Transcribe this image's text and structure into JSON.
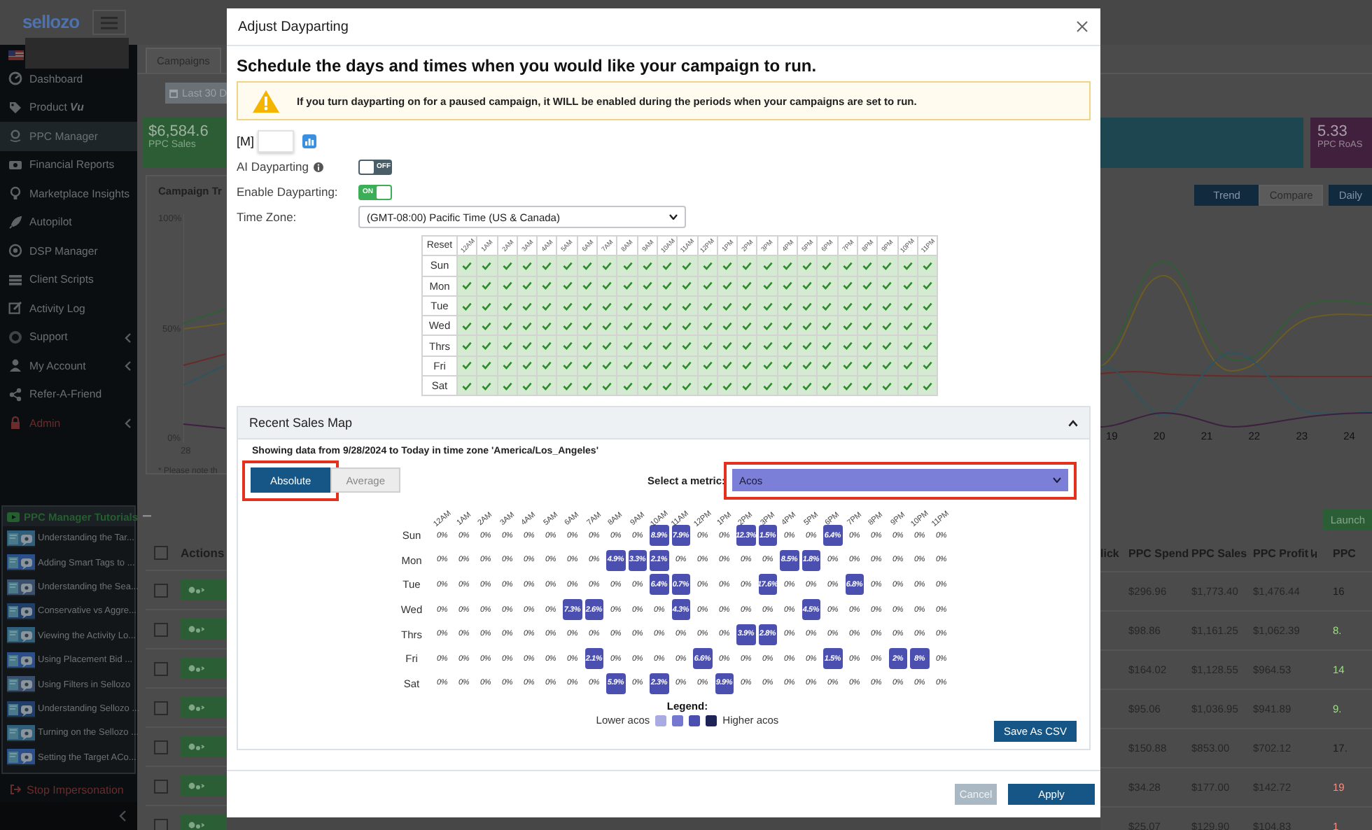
{
  "sidebar": {
    "logo": "sellozo",
    "items": [
      {
        "label": "Dashboard",
        "kind": "link",
        "submenu": false,
        "selected": false
      },
      {
        "label": "Product **Vu**",
        "kind": "link",
        "submenu": false,
        "selected": false
      },
      {
        "label": "PPC Manager",
        "kind": "link",
        "submenu": false,
        "selected": true
      },
      {
        "label": "Financial Reports",
        "kind": "link",
        "submenu": false,
        "selected": false
      },
      {
        "label": "Marketplace Insights",
        "kind": "link",
        "submenu": false,
        "selected": false
      },
      {
        "label": "Autopilot",
        "kind": "link",
        "submenu": false,
        "selected": false
      },
      {
        "label": "DSP Manager",
        "kind": "link",
        "submenu": false,
        "selected": false
      },
      {
        "label": "Client Scripts",
        "kind": "link",
        "submenu": false,
        "selected": false
      },
      {
        "label": "Activity Log",
        "kind": "link",
        "submenu": false,
        "selected": false
      },
      {
        "label": "Support",
        "kind": "link",
        "submenu": true,
        "selected": false
      },
      {
        "label": "My Account",
        "kind": "link",
        "submenu": true,
        "selected": false
      },
      {
        "label": "Refer-A-Friend",
        "kind": "link",
        "submenu": false,
        "selected": false
      },
      {
        "label": "Admin",
        "kind": "danger",
        "submenu": true,
        "selected": false
      }
    ],
    "tutorials": {
      "title": "PPC Manager Tutorials",
      "items": [
        "Understanding the Tar...",
        "Adding Smart Tags to ...",
        "Understanding the Sea...",
        "Conservative vs Aggre...",
        "Viewing the Activity Lo...",
        "Using Placement Bid ...",
        "Using Filters in Sellozo",
        "Understanding Sellozo ...",
        "Turning on the Sellozo ...",
        "Setting the Target ACo..."
      ]
    },
    "stop_impersonation": "Stop Impersonation"
  },
  "campaign_pane_left": {
    "tab": "Campaigns",
    "date_button": "Last 30 D",
    "sales_card": {
      "value": "$6,584.6",
      "label": "PPC Sales"
    },
    "chart": {
      "title": "Campaign Tr",
      "y_labels": [
        "100%",
        "50%",
        "0%"
      ],
      "x_labels": [
        "28"
      ],
      "note": "* Please note th"
    },
    "table": {
      "header": "Actions",
      "select_all_checked": false,
      "rows": [
        {
          "checked": false
        },
        {
          "checked": false
        },
        {
          "checked": false
        },
        {
          "checked": false
        },
        {
          "checked": false
        },
        {
          "checked": false
        },
        {
          "checked": false
        }
      ]
    }
  },
  "modal": {
    "title": "Adjust Dayparting",
    "heading": "Schedule the days and times when you would like your campaign to run.",
    "warning": "If you turn dayparting on for a paused campaign, it WILL be enabled during the periods when your campaigns are set to run.",
    "m_label": "[M]",
    "ai_dayparting": {
      "label": "AI Dayparting",
      "on": false,
      "text": "OFF"
    },
    "enable_dayparting": {
      "label": "Enable Dayparting:",
      "on": true,
      "text": "ON"
    },
    "time_zone": {
      "label": "Time Zone:",
      "value": "(GMT-08:00) Pacific Time (US & Canada)"
    },
    "schedule": {
      "reset": "Reset",
      "hours": [
        "12AM",
        "1AM",
        "2AM",
        "3AM",
        "4AM",
        "5AM",
        "6AM",
        "7AM",
        "8AM",
        "9AM",
        "10AM",
        "11AM",
        "12PM",
        "1PM",
        "2PM",
        "3PM",
        "4PM",
        "5PM",
        "6PM",
        "7PM",
        "8PM",
        "9PM",
        "10PM",
        "11PM"
      ],
      "days": [
        {
          "label": "Sun",
          "checked": [
            true,
            true,
            true,
            true,
            true,
            true,
            true,
            true,
            true,
            true,
            true,
            true,
            true,
            true,
            true,
            true,
            true,
            true,
            true,
            true,
            true,
            true,
            true,
            true
          ]
        },
        {
          "label": "Mon",
          "checked": [
            true,
            true,
            true,
            true,
            true,
            true,
            true,
            true,
            true,
            true,
            true,
            true,
            true,
            true,
            true,
            true,
            true,
            true,
            true,
            true,
            true,
            true,
            true,
            true
          ]
        },
        {
          "label": "Tue",
          "checked": [
            true,
            true,
            true,
            true,
            true,
            true,
            true,
            true,
            true,
            true,
            true,
            true,
            true,
            true,
            true,
            true,
            true,
            true,
            true,
            true,
            true,
            true,
            true,
            true
          ]
        },
        {
          "label": "Wed",
          "checked": [
            true,
            true,
            true,
            true,
            true,
            true,
            true,
            true,
            true,
            true,
            true,
            true,
            true,
            true,
            true,
            true,
            true,
            true,
            true,
            true,
            true,
            true,
            true,
            true
          ]
        },
        {
          "label": "Thrs",
          "checked": [
            true,
            true,
            true,
            true,
            true,
            true,
            true,
            true,
            true,
            true,
            true,
            true,
            true,
            true,
            true,
            true,
            true,
            true,
            true,
            true,
            true,
            true,
            true,
            true
          ]
        },
        {
          "label": "Fri",
          "checked": [
            true,
            true,
            true,
            true,
            true,
            true,
            true,
            true,
            true,
            true,
            true,
            true,
            true,
            true,
            true,
            true,
            true,
            true,
            true,
            true,
            true,
            true,
            true,
            true
          ]
        },
        {
          "label": "Sat",
          "checked": [
            true,
            true,
            true,
            true,
            true,
            true,
            true,
            true,
            true,
            true,
            true,
            true,
            true,
            true,
            true,
            true,
            true,
            true,
            true,
            true,
            true,
            true,
            true,
            true
          ]
        }
      ]
    },
    "sales_map": {
      "title": "Recent Sales Map",
      "expanded": true,
      "range_text": "Showing data from 9/28/2024 to Today in time zone 'America/Los_Angeles'",
      "modes": [
        {
          "label": "Absolute",
          "selected": true,
          "highlighted": true
        },
        {
          "label": "Average",
          "selected": false,
          "highlighted": false
        }
      ],
      "metric": {
        "label": "Select a metric:",
        "value": "Acos",
        "highlighted": true
      },
      "hours": [
        "12AM",
        "1AM",
        "2AM",
        "3AM",
        "4AM",
        "5AM",
        "6AM",
        "7AM",
        "8AM",
        "9AM",
        "10AM",
        "11AM",
        "12PM",
        "1PM",
        "2PM",
        "3PM",
        "4PM",
        "5PM",
        "6PM",
        "7PM",
        "8PM",
        "9PM",
        "10PM",
        "11PM"
      ],
      "rows": [
        {
          "day": "Sun",
          "cells": [
            {
              "text": "0%"
            },
            {
              "text": "0%"
            },
            {
              "text": "0%"
            },
            {
              "text": "0%"
            },
            {
              "text": "0%"
            },
            {
              "text": "0%"
            },
            {
              "text": "0%"
            },
            {
              "text": "0%"
            },
            {
              "text": "0%"
            },
            {
              "text": "0%"
            },
            {
              "text": "8.9%",
              "color": "#4b50b0"
            },
            {
              "text": "7.9%",
              "color": "#4b50b0"
            },
            {
              "text": "0%"
            },
            {
              "text": "0%"
            },
            {
              "text": "12.3%",
              "color": "#4b50b0"
            },
            {
              "text": "1.5%",
              "color": "#4b50b0"
            },
            {
              "text": "0%"
            },
            {
              "text": "0%"
            },
            {
              "text": "6.4%",
              "color": "#4b50b0"
            },
            {
              "text": "0%"
            },
            {
              "text": "0%"
            },
            {
              "text": "0%"
            },
            {
              "text": "0%"
            },
            {
              "text": "0%"
            }
          ]
        },
        {
          "day": "Mon",
          "cells": [
            {
              "text": "0%"
            },
            {
              "text": "0%"
            },
            {
              "text": "0%"
            },
            {
              "text": "0%"
            },
            {
              "text": "0%"
            },
            {
              "text": "0%"
            },
            {
              "text": "0%"
            },
            {
              "text": "0%"
            },
            {
              "text": "4.9%",
              "color": "#4b50b0"
            },
            {
              "text": "3.3%",
              "color": "#4b50b0"
            },
            {
              "text": "2.1%",
              "color": "#4b50b0"
            },
            {
              "text": "0%"
            },
            {
              "text": "0%"
            },
            {
              "text": "0%"
            },
            {
              "text": "0%"
            },
            {
              "text": "0%"
            },
            {
              "text": "8.5%",
              "color": "#4b50b0"
            },
            {
              "text": "1.8%",
              "color": "#4b50b0"
            },
            {
              "text": "0%"
            },
            {
              "text": "0%"
            },
            {
              "text": "0%"
            },
            {
              "text": "0%"
            },
            {
              "text": "0%"
            },
            {
              "text": "0%"
            }
          ]
        },
        {
          "day": "Tue",
          "cells": [
            {
              "text": "0%"
            },
            {
              "text": "0%"
            },
            {
              "text": "0%"
            },
            {
              "text": "0%"
            },
            {
              "text": "0%"
            },
            {
              "text": "0%"
            },
            {
              "text": "0%"
            },
            {
              "text": "0%"
            },
            {
              "text": "0%"
            },
            {
              "text": "0%"
            },
            {
              "text": "6.4%",
              "color": "#4b50b0"
            },
            {
              "text": "0.7%",
              "color": "#4b50b0"
            },
            {
              "text": "0%"
            },
            {
              "text": "0%"
            },
            {
              "text": "0%"
            },
            {
              "text": "17.6%",
              "color": "#4b50b0"
            },
            {
              "text": "0%"
            },
            {
              "text": "0%"
            },
            {
              "text": "0%"
            },
            {
              "text": "6.8%",
              "color": "#4b50b0"
            },
            {
              "text": "0%"
            },
            {
              "text": "0%"
            },
            {
              "text": "0%"
            },
            {
              "text": "0%"
            }
          ]
        },
        {
          "day": "Wed",
          "cells": [
            {
              "text": "0%"
            },
            {
              "text": "0%"
            },
            {
              "text": "0%"
            },
            {
              "text": "0%"
            },
            {
              "text": "0%"
            },
            {
              "text": "0%"
            },
            {
              "text": "7.3%",
              "color": "#4b50b0"
            },
            {
              "text": "2.6%",
              "color": "#4b50b0"
            },
            {
              "text": "0%"
            },
            {
              "text": "0%"
            },
            {
              "text": "0%"
            },
            {
              "text": "4.3%",
              "color": "#4b50b0"
            },
            {
              "text": "0%"
            },
            {
              "text": "0%"
            },
            {
              "text": "0%"
            },
            {
              "text": "0%"
            },
            {
              "text": "0%"
            },
            {
              "text": "4.5%",
              "color": "#4b50b0"
            },
            {
              "text": "0%"
            },
            {
              "text": "0%"
            },
            {
              "text": "0%"
            },
            {
              "text": "0%"
            },
            {
              "text": "0%"
            },
            {
              "text": "0%"
            }
          ]
        },
        {
          "day": "Thrs",
          "cells": [
            {
              "text": "0%"
            },
            {
              "text": "0%"
            },
            {
              "text": "0%"
            },
            {
              "text": "0%"
            },
            {
              "text": "0%"
            },
            {
              "text": "0%"
            },
            {
              "text": "0%"
            },
            {
              "text": "0%"
            },
            {
              "text": "0%"
            },
            {
              "text": "0%"
            },
            {
              "text": "0%"
            },
            {
              "text": "0%"
            },
            {
              "text": "0%"
            },
            {
              "text": "0%"
            },
            {
              "text": "3.9%",
              "color": "#4b50b0"
            },
            {
              "text": "2.8%",
              "color": "#4b50b0"
            },
            {
              "text": "0%"
            },
            {
              "text": "0%"
            },
            {
              "text": "0%"
            },
            {
              "text": "0%"
            },
            {
              "text": "0%"
            },
            {
              "text": "0%"
            },
            {
              "text": "0%"
            },
            {
              "text": "0%"
            }
          ]
        },
        {
          "day": "Fri",
          "cells": [
            {
              "text": "0%"
            },
            {
              "text": "0%"
            },
            {
              "text": "0%"
            },
            {
              "text": "0%"
            },
            {
              "text": "0%"
            },
            {
              "text": "0%"
            },
            {
              "text": "0%"
            },
            {
              "text": "2.1%",
              "color": "#4b50b0"
            },
            {
              "text": "0%"
            },
            {
              "text": "0%"
            },
            {
              "text": "0%"
            },
            {
              "text": "0%"
            },
            {
              "text": "6.6%",
              "color": "#4b50b0"
            },
            {
              "text": "0%"
            },
            {
              "text": "0%"
            },
            {
              "text": "0%"
            },
            {
              "text": "0%"
            },
            {
              "text": "0%"
            },
            {
              "text": "1.5%",
              "color": "#4b50b0"
            },
            {
              "text": "0%"
            },
            {
              "text": "0%"
            },
            {
              "text": "2%",
              "color": "#4b50b0"
            },
            {
              "text": "8%",
              "color": "#4b50b0"
            },
            {
              "text": "0%"
            }
          ]
        },
        {
          "day": "Sat",
          "cells": [
            {
              "text": "0%"
            },
            {
              "text": "0%"
            },
            {
              "text": "0%"
            },
            {
              "text": "0%"
            },
            {
              "text": "0%"
            },
            {
              "text": "0%"
            },
            {
              "text": "0%"
            },
            {
              "text": "0%"
            },
            {
              "text": "5.9%",
              "color": "#4b50b0"
            },
            {
              "text": "0%"
            },
            {
              "text": "2.3%",
              "color": "#4b50b0"
            },
            {
              "text": "0%"
            },
            {
              "text": "0%"
            },
            {
              "text": "9.9%",
              "color": "#4b50b0"
            },
            {
              "text": "0%"
            },
            {
              "text": "0%"
            },
            {
              "text": "0%"
            },
            {
              "text": "0%"
            },
            {
              "text": "0%"
            },
            {
              "text": "0%"
            },
            {
              "text": "0%"
            },
            {
              "text": "0%"
            },
            {
              "text": "0%"
            },
            {
              "text": "0%"
            }
          ]
        }
      ],
      "legend": {
        "title": "Legend:",
        "low": "Lower acos",
        "high": "Higher acos",
        "swatches": [
          {
            "color": "#a9abe3"
          },
          {
            "color": "#7478d0"
          },
          {
            "color": "#4b50b0"
          },
          {
            "color": "#1e2458"
          }
        ]
      },
      "save_button": "Save As CSV"
    },
    "buttons": [
      {
        "label": "Cancel",
        "kind": "secondary",
        "disabled": true
      },
      {
        "label": "Apply",
        "kind": "primary",
        "disabled": false
      }
    ]
  },
  "campaign_pane_right": {
    "roas_card": {
      "value": "5.33",
      "label": "PPC RoAS"
    },
    "view_buttons": [
      {
        "label": "Trend",
        "selected": true
      },
      {
        "label": "Compare",
        "selected": false
      },
      {
        "label": "Daily",
        "selected": true
      }
    ],
    "chart_x_labels": [
      "19",
      "20",
      "21",
      "22",
      "23",
      "24"
    ],
    "launch_button": "Launch",
    "table": {
      "columns": [
        "lick",
        "PPC Spend",
        "PPC Sales",
        "PPC Profit",
        "PPC"
      ],
      "rows": [
        {
          "cells": [
            "",
            "$296.96",
            "$1,773.40",
            "$1,476.44",
            "16"
          ],
          "color": "#1a1a1a"
        },
        {
          "cells": [
            "",
            "$98.86",
            "$1,161.25",
            "$1,062.39",
            "8."
          ],
          "color": "#9be07f"
        },
        {
          "cells": [
            "",
            "$164.02",
            "$1,128.55",
            "$964.53",
            "14"
          ],
          "color": "#9be07f"
        },
        {
          "cells": [
            "",
            "$95.06",
            "$1,036.95",
            "$941.89",
            "9."
          ],
          "color": "#9be07f"
        },
        {
          "cells": [
            "",
            "$150.88",
            "$853.00",
            "$702.12",
            "17."
          ],
          "color": "#1a1a1a"
        },
        {
          "cells": [
            "",
            "$34.28",
            "$177.00",
            "$142.72",
            "19"
          ],
          "color": "#ff8a7e"
        },
        {
          "cells": [
            "",
            "$25.07",
            "$129.90",
            "$104.83",
            "1"
          ],
          "color": "#ff8a7e"
        }
      ]
    }
  }
}
